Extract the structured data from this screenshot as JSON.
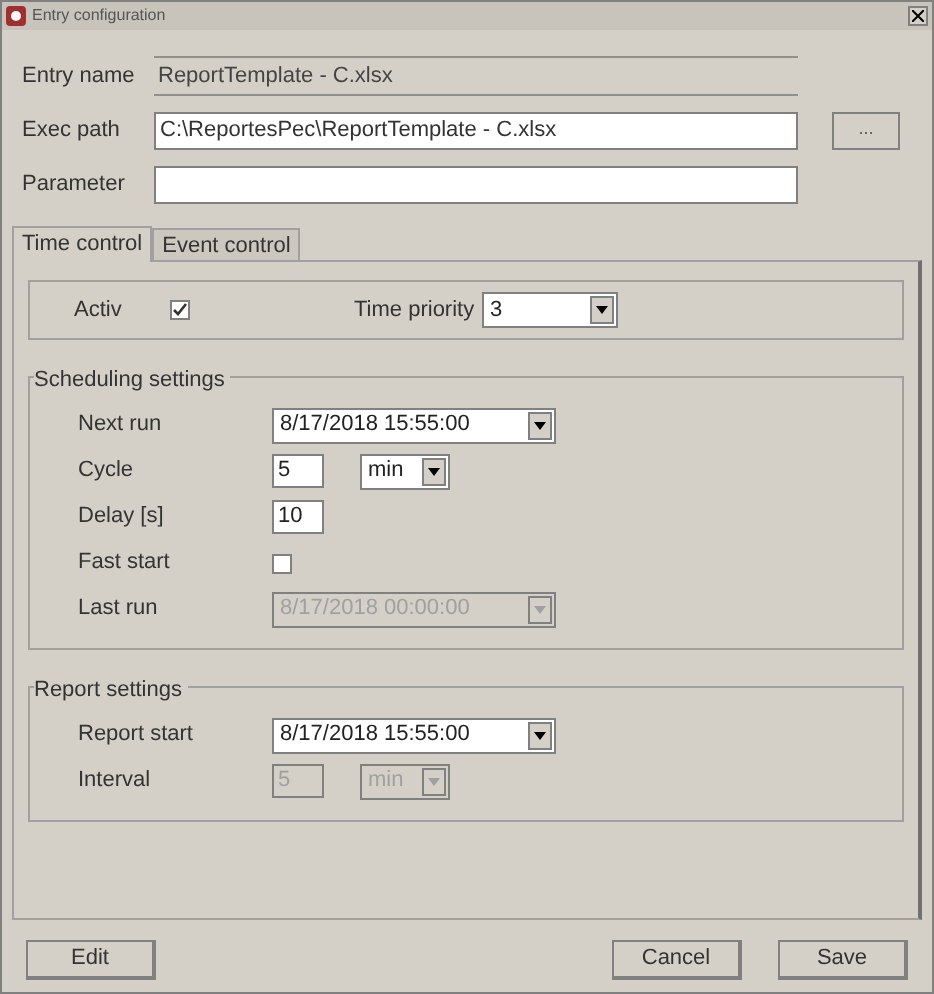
{
  "window": {
    "title": "Entry configuration"
  },
  "entry_name": {
    "label": "Entry name",
    "value": "ReportTemplate - C.xlsx"
  },
  "exec_path": {
    "label": "Exec path",
    "value": "C:\\ReportesPec\\ReportTemplate - C.xlsx",
    "browse": "..."
  },
  "parameter": {
    "label": "Parameter"
  },
  "tabs": [
    {
      "label": "Time control",
      "selected": true
    },
    {
      "label": "Event control",
      "selected": false
    }
  ],
  "activ": {
    "label": "Activ",
    "checked": true
  },
  "time_priority": {
    "label": "Time priority",
    "value": "3"
  },
  "groups": [
    {
      "title": "Scheduling settings",
      "rows": [
        {
          "kind": "datetime",
          "label": "Next run",
          "value": "8/17/2018 15:55:00",
          "disabled": false
        },
        {
          "kind": "number_unit",
          "label": "Cycle",
          "value": "5",
          "unit": "min",
          "disabled": false
        },
        {
          "kind": "number",
          "label": "Delay [s]",
          "value": "10",
          "disabled": false
        },
        {
          "kind": "checkbox",
          "label": "Fast start",
          "checked": false,
          "disabled": false
        },
        {
          "kind": "datetime",
          "label": "Last run",
          "value": "8/17/2018 00:00:00",
          "disabled": true
        }
      ]
    },
    {
      "title": "Report settings",
      "rows": [
        {
          "kind": "datetime",
          "label": "Report start",
          "value": "8/17/2018 15:55:00",
          "disabled": false
        },
        {
          "kind": "number_unit",
          "label": "Interval",
          "value": "5",
          "unit": "min",
          "disabled": true
        }
      ]
    }
  ],
  "buttons": {
    "left": [
      "Edit"
    ],
    "right": [
      "Cancel",
      "Save"
    ]
  }
}
